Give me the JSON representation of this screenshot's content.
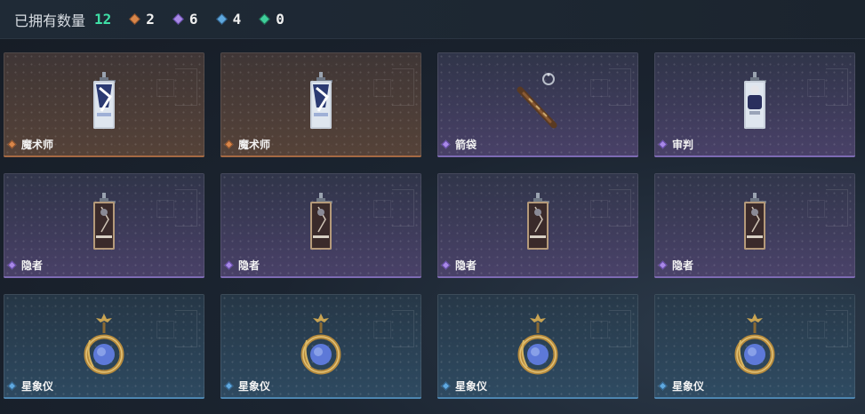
{
  "header": {
    "owned_label": "已拥有数量",
    "owned_total": "12",
    "counts": [
      {
        "rarity": "orange",
        "value": "2"
      },
      {
        "rarity": "purple",
        "value": "6"
      },
      {
        "rarity": "blue",
        "value": "4"
      },
      {
        "rarity": "green",
        "value": "0"
      }
    ]
  },
  "colors": {
    "orange": "#d9874a",
    "purple": "#a889e6",
    "blue": "#5fa8de",
    "green": "#3fcf9b",
    "total_accent": "#3fe0a6"
  },
  "items": [
    {
      "name": "魔术师",
      "rarity": "orange",
      "icon": "tarot-card-magician-icon"
    },
    {
      "name": "魔术师",
      "rarity": "orange",
      "icon": "tarot-card-magician-icon"
    },
    {
      "name": "箭袋",
      "rarity": "purple",
      "icon": "quiver-icon"
    },
    {
      "name": "审判",
      "rarity": "purple",
      "icon": "tarot-card-judgement-icon"
    },
    {
      "name": "隐者",
      "rarity": "purple",
      "icon": "tarot-card-hermit-icon"
    },
    {
      "name": "隐者",
      "rarity": "purple",
      "icon": "tarot-card-hermit-icon"
    },
    {
      "name": "隐者",
      "rarity": "purple",
      "icon": "tarot-card-hermit-icon"
    },
    {
      "name": "隐者",
      "rarity": "purple",
      "icon": "tarot-card-hermit-icon"
    },
    {
      "name": "星象仪",
      "rarity": "blue",
      "icon": "astrolabe-pendant-icon"
    },
    {
      "name": "星象仪",
      "rarity": "blue",
      "icon": "astrolabe-pendant-icon"
    },
    {
      "name": "星象仪",
      "rarity": "blue",
      "icon": "astrolabe-pendant-icon"
    },
    {
      "name": "星象仪",
      "rarity": "blue",
      "icon": "astrolabe-pendant-icon"
    }
  ]
}
